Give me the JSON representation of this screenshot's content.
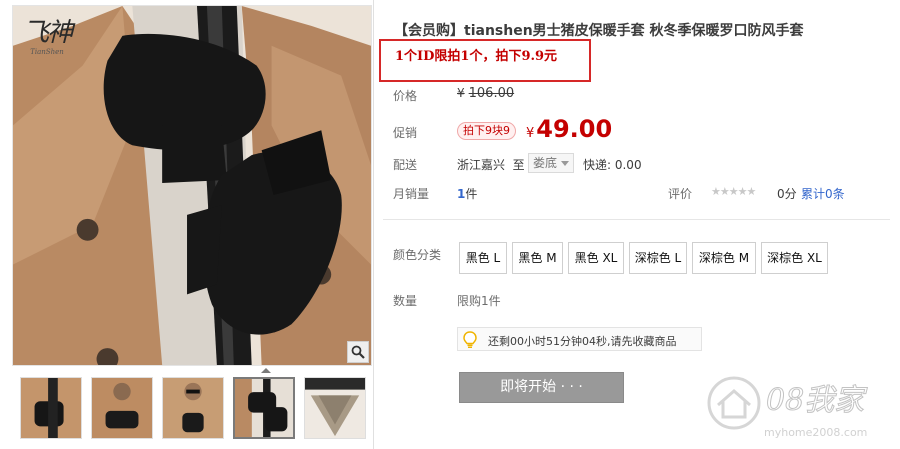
{
  "gallery": {
    "brand_logo_text": "飞神",
    "brand_logo_sub": "TianShen",
    "zoom_icon": "magnifier-icon",
    "thumbnails": [
      "thumb-1",
      "thumb-2",
      "thumb-3",
      "thumb-4",
      "thumb-5"
    ],
    "active_thumbnail_index": 3
  },
  "product": {
    "title": "【会员购】tianshen男士猪皮保暖手套 秋冬季保暖罗口防风手套",
    "promo_note": "1个ID限拍1个，拍下9.9元"
  },
  "price": {
    "label": "价格",
    "currency": "¥",
    "original": "106.00"
  },
  "promotion": {
    "label": "促销",
    "badge": "拍下9块9",
    "currency": "¥",
    "price": "49.00"
  },
  "shipping": {
    "label": "配送",
    "origin": "浙江嘉兴",
    "to": "至",
    "destination": "娄底",
    "fee_text": "快递: 0.00"
  },
  "sales": {
    "label": "月销量",
    "count": "1",
    "unit": "件"
  },
  "rating": {
    "label": "评价",
    "stars": "★★★★★",
    "score": "0分",
    "reviews_link": "累计0条"
  },
  "options": {
    "label": "颜色分类",
    "colors": [
      "黑色 L",
      "黑色 M",
      "黑色 XL",
      "深棕色 L",
      "深棕色 M",
      "深棕色 XL"
    ]
  },
  "quantity": {
    "label": "数量",
    "limit": "限购1件"
  },
  "tip": {
    "icon": "lightbulb-icon",
    "text": "还剩00小时51分钟04秒,请先收藏商品"
  },
  "action": {
    "button_label": "即将开始 · · ·"
  },
  "watermark": {
    "text": "08我家",
    "url": "myhome2008.com"
  },
  "colors": {
    "accent_red": "#c40000",
    "link_blue": "#3366cc",
    "button_gray": "#999999",
    "highlight_box": "#d62828"
  }
}
